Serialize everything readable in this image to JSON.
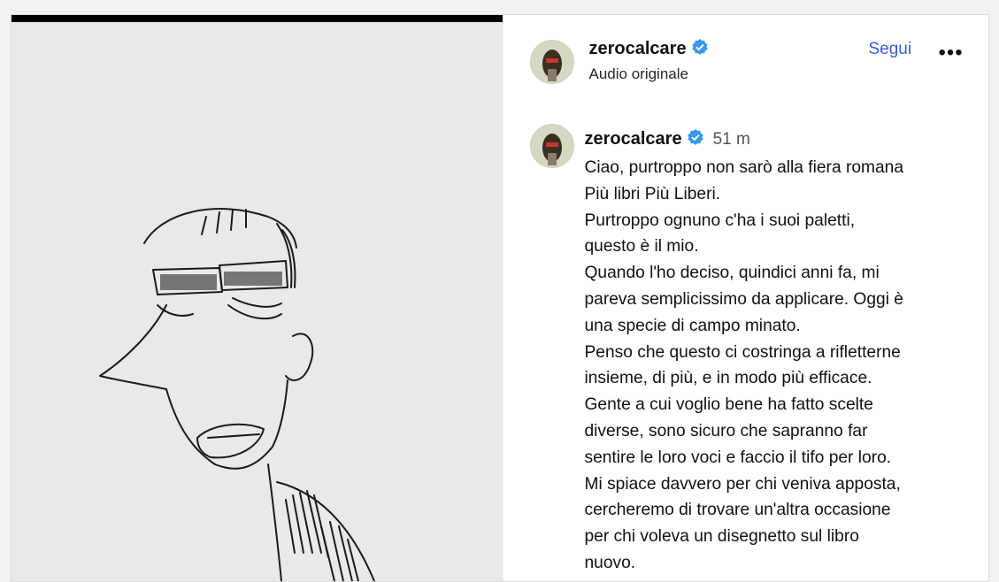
{
  "post": {
    "author": {
      "username": "zerocalcare",
      "verified": true,
      "audio_label": "Audio originale",
      "follow_label": "Segui",
      "more_icon": "more-options-icon"
    },
    "comment": {
      "username": "zerocalcare",
      "time": "51 m",
      "lines": [
        "Ciao, purtroppo non sarò alla fiera romana",
        "Più libri Più Liberi.",
        "Purtroppo ognuno c'ha i suoi paletti,",
        "questo è il mio.",
        "Quando l'ho deciso, quindici anni fa, mi",
        "pareva semplicissimo da applicare. Oggi è",
        "una specie di campo minato.",
        "Penso che questo ci costringa a rifletterne",
        "insieme, di più, e in modo più efficace.",
        "Gente a cui voglio bene ha fatto scelte",
        "diverse, sono sicuro che sapranno far",
        "sentire le loro voci e faccio il tifo per loro.",
        "Mi spiace davvero per chi veniva apposta,",
        "cercheremo di trovare un'altra occasione",
        "per chi voleva un disegnetto sul libro",
        "nuovo."
      ]
    }
  },
  "colors": {
    "link": "#3b5bdb",
    "verified": "#3797f0",
    "text": "#111111"
  }
}
